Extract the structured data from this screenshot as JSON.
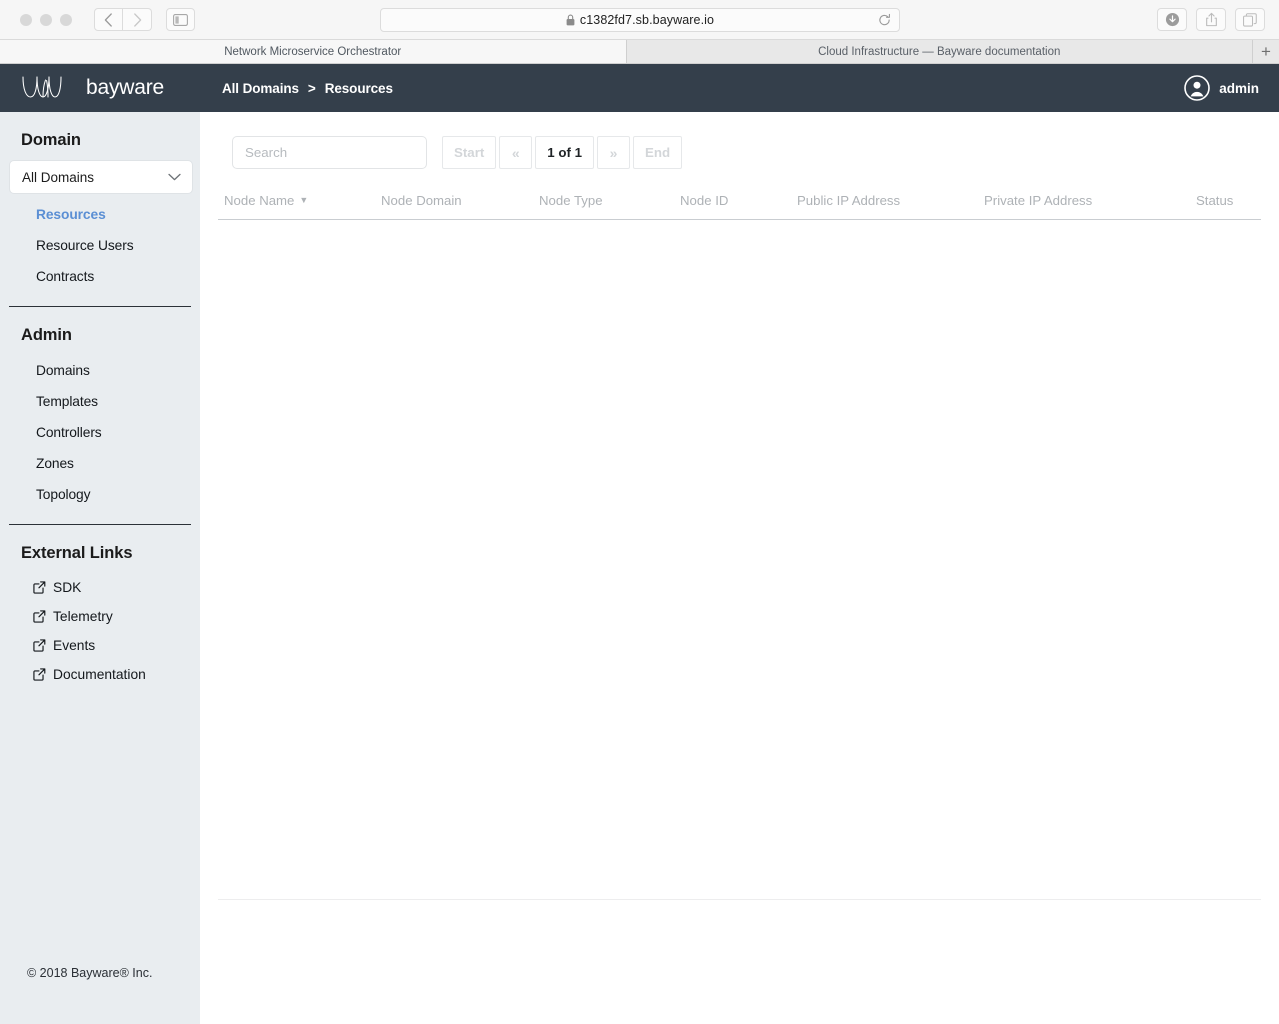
{
  "browser": {
    "url": "c1382fd7.sb.bayware.io",
    "lock_icon": "lock-icon",
    "back_icon": "chevron-left-icon",
    "forward_icon": "chevron-right-icon",
    "sidebar_toggle_icon": "sidebar-toggle-icon",
    "reload_icon": "reload-icon",
    "download_icon": "download-icon",
    "share_icon": "share-icon",
    "tabs_overview_icon": "tabs-overview-icon",
    "new_tab_label": "+",
    "tabs": [
      {
        "label": "Network Microservice Orchestrator",
        "active": true
      },
      {
        "label": "Cloud Infrastructure — Bayware documentation",
        "active": false
      }
    ]
  },
  "sidebar": {
    "logo_text": "bayware",
    "logo_icon": "bayware-wave-logo-icon",
    "domain_heading": "Domain",
    "domain_select": {
      "value": "All Domains",
      "chevron_icon": "chevron-down-icon"
    },
    "domain_items": [
      {
        "label": "Resources",
        "active": true
      },
      {
        "label": "Resource Users",
        "active": false
      },
      {
        "label": "Contracts",
        "active": false
      }
    ],
    "admin_heading": "Admin",
    "admin_items": [
      {
        "label": "Domains"
      },
      {
        "label": "Templates"
      },
      {
        "label": "Controllers"
      },
      {
        "label": "Zones"
      },
      {
        "label": "Topology"
      }
    ],
    "external_heading": "External Links",
    "external_items": [
      {
        "label": "SDK",
        "icon": "external-link-icon"
      },
      {
        "label": "Telemetry",
        "icon": "external-link-icon"
      },
      {
        "label": "Events",
        "icon": "external-link-icon"
      },
      {
        "label": "Documentation",
        "icon": "external-link-icon"
      }
    ],
    "footer": "© 2018 Bayware® Inc."
  },
  "topbar": {
    "breadcrumb": {
      "root": "All Domains",
      "separator": ">",
      "current": "Resources"
    },
    "user": {
      "name": "admin",
      "avatar_icon": "user-avatar-icon"
    }
  },
  "toolbar": {
    "search_placeholder": "Search",
    "search_value": "",
    "pagination": {
      "start_label": "Start",
      "prev_label": "«",
      "page_label": "1 of 1",
      "next_label": "»",
      "end_label": "End"
    }
  },
  "table": {
    "columns": [
      {
        "label": "Node Name",
        "sorted": true,
        "sort_icon": "sort-desc-caret-icon"
      },
      {
        "label": "Node Domain",
        "sorted": false
      },
      {
        "label": "Node Type",
        "sorted": false
      },
      {
        "label": "Node ID",
        "sorted": false
      },
      {
        "label": "Public IP Address",
        "sorted": false
      },
      {
        "label": "Private IP Address",
        "sorted": false
      },
      {
        "label": "Status",
        "sorted": false
      }
    ],
    "rows": []
  },
  "colors": {
    "navy": "#343f4b",
    "sidebar_bg": "#e9edf0",
    "accent_blue": "#5b8fd4",
    "muted": "#aeb2b6"
  }
}
